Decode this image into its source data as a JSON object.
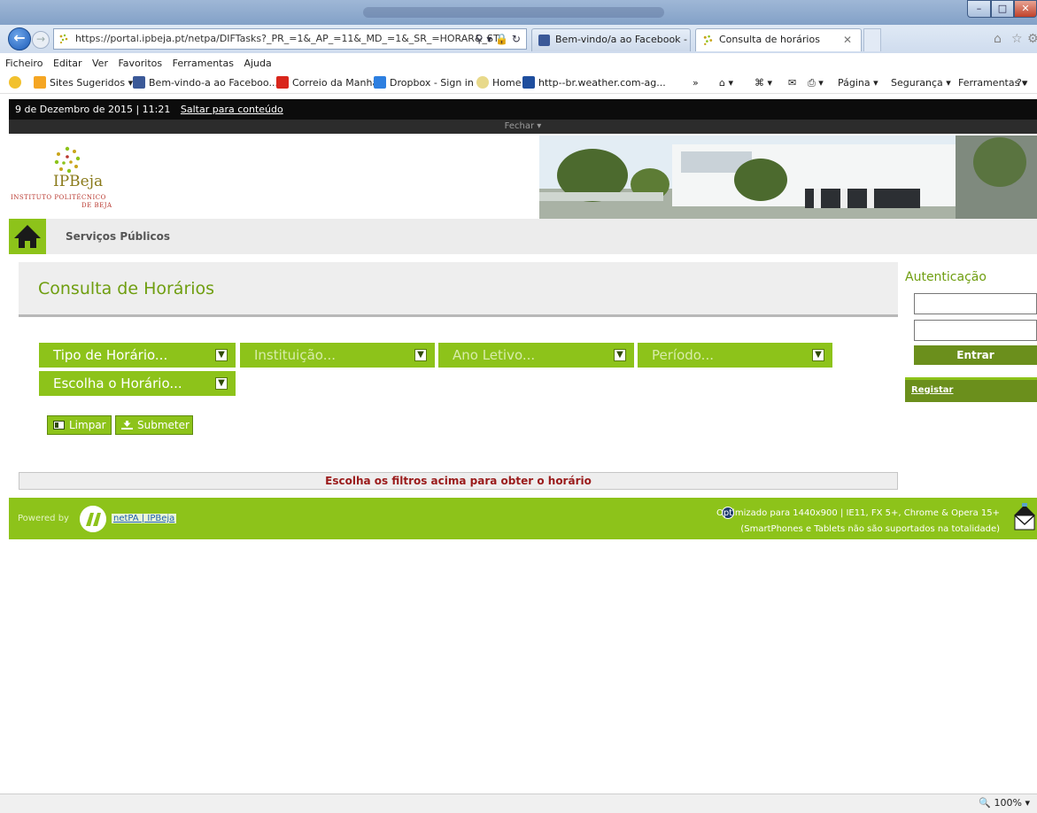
{
  "browser": {
    "address": "https://portal.ipbeja.pt/netpa/DIFTasks?_PR_=1&_AP_=11&_MD_=1&_SR_=HORAR&_ST",
    "tabs": [
      {
        "label": "Bem-vindo/a ao Facebook - In..."
      },
      {
        "label": "Consulta de horários"
      }
    ],
    "menu": [
      "Ficheiro",
      "Editar",
      "Ver",
      "Favoritos",
      "Ferramentas",
      "Ajuda"
    ],
    "favorites": [
      {
        "label": "Sites Sugeridos ▾"
      },
      {
        "label": "Bem-vindo-a ao Faceboo..."
      },
      {
        "label": "Correio da Manhã"
      },
      {
        "label": "Dropbox - Sign in"
      },
      {
        "label": "Home"
      },
      {
        "label": "http--br.weather.com-ag..."
      }
    ],
    "command_bar": [
      "Página ▾",
      "Segurança ▾",
      "Ferramentas ▾"
    ],
    "zoom": "100%"
  },
  "page": {
    "top_bar": {
      "date": "9 de Dezembro de 2015 | 11:21",
      "skip": "Saltar para conteúdo"
    },
    "close_label": "Fechar",
    "logo": {
      "name": "IPBeja",
      "line1": "INSTITUTO POLITÉCNICO",
      "line2": "DE BEJA"
    },
    "nav_label": "Serviços Públicos",
    "title": "Consulta de Horários",
    "filters": [
      {
        "label": "Tipo de Horário...",
        "enabled": true
      },
      {
        "label": "Instituição...",
        "enabled": false
      },
      {
        "label": "Ano Letivo...",
        "enabled": false
      },
      {
        "label": "Período...",
        "enabled": false
      },
      {
        "label": "Escolha o Horário...",
        "enabled": true
      }
    ],
    "buttons": {
      "clear": "Limpar",
      "submit": "Submeter"
    },
    "result_message": "Escolha os filtros acima para obter o horário",
    "auth": {
      "title": "Autenticação",
      "login": "Entrar",
      "register": "Registar"
    },
    "footer": {
      "powered": "Powered by",
      "link": "netPA | IPBeja",
      "opt1": "Optimizado para 1440x900 | IE11, FX 5+, Chrome & Opera 15+",
      "opt2": "(SmartPhones e Tablets não são suportados na totalidade)"
    }
  },
  "colors": {
    "accent": "#8dc31a",
    "accent_dark": "#6b8f1c",
    "title": "#6f9e10",
    "error_text": "#9a1b1b"
  }
}
